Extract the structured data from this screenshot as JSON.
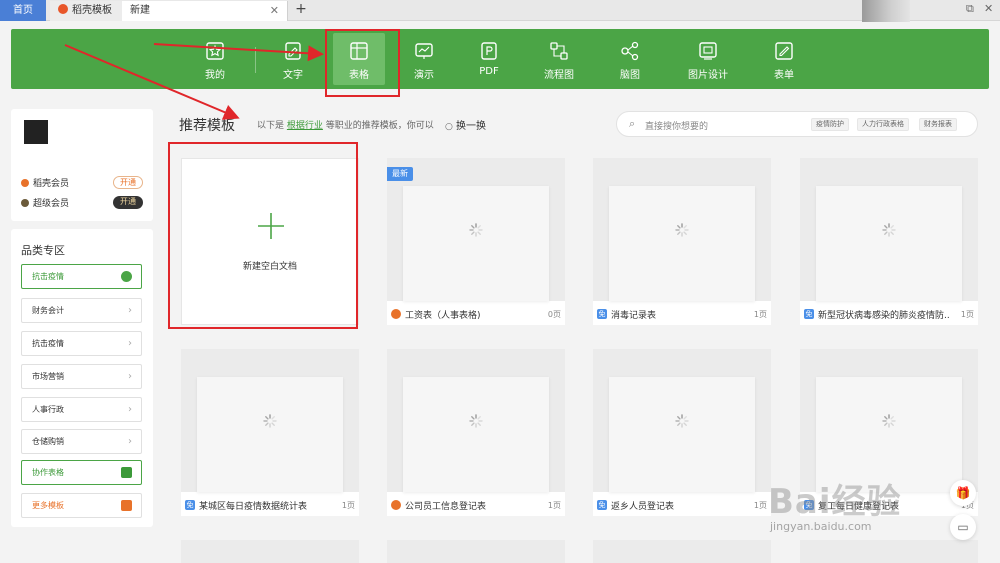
{
  "tabs": {
    "home": "首页",
    "docer": "稻壳模板",
    "new": "新建",
    "close_glyph": "✕",
    "add_glyph": "+"
  },
  "window": {
    "restore_glyph": "⧉",
    "close_glyph": "✕"
  },
  "toolbar": {
    "items": [
      {
        "label": "我的",
        "icon": "star-icon"
      },
      {
        "label": "文字",
        "icon": "writer-doc-icon"
      },
      {
        "label": "表格",
        "icon": "spreadsheet-icon",
        "active": true
      },
      {
        "label": "演示",
        "icon": "presentation-icon"
      },
      {
        "label": "PDF",
        "icon": "pdf-icon"
      },
      {
        "label": "流程图",
        "icon": "flowchart-icon"
      },
      {
        "label": "脑图",
        "icon": "mindmap-icon"
      },
      {
        "label": "图片设计",
        "icon": "image-design-icon"
      },
      {
        "label": "表单",
        "icon": "form-icon"
      }
    ],
    "bg_color": "#4ba546"
  },
  "user": {
    "docer_vip": "稻壳会员",
    "docer_vip_btn": "开通",
    "super_vip": "超级会员",
    "super_vip_btn": "开通"
  },
  "category": {
    "title": "品类专区",
    "items": [
      {
        "label": "抗击疫情",
        "style": "green"
      },
      {
        "label": "财务会计"
      },
      {
        "label": "抗击疫情"
      },
      {
        "label": "市场营销"
      },
      {
        "label": "人事行政"
      },
      {
        "label": "仓储购销"
      },
      {
        "label": "协作表格",
        "style": "green"
      },
      {
        "label": "更多模板",
        "style": "orange"
      }
    ]
  },
  "main": {
    "title": "推荐模板",
    "desc_prefix": "以下是",
    "desc_link": "根据行业",
    "desc_suffix": "等职业的推荐模板，你可以",
    "refresh_label": "换一换",
    "search_placeholder": "直接搜你想要的",
    "chips": [
      "疫情防护",
      "人力行政表格",
      "财务报表"
    ],
    "blank_label": "新建空白文档",
    "new_badge": "最新",
    "cards_row1": [
      {
        "name": "工资表（人事表格)",
        "pages": "0页",
        "tag": "docer"
      },
      {
        "name": "消毒记录表",
        "pages": "1页",
        "tag": "free"
      },
      {
        "name": "新型冠状病毒感染的肺炎疫情防...",
        "pages": "1页",
        "tag": "free"
      }
    ],
    "cards_row2": [
      {
        "name": "某城区每日疫情数据统计表",
        "pages": "1页",
        "tag": "free"
      },
      {
        "name": "公司员工信息登记表",
        "pages": "1页",
        "tag": "docer"
      },
      {
        "name": "返乡人员登记表",
        "pages": "1页",
        "tag": "free"
      },
      {
        "name": "复工每日健康登记表",
        "pages": "1页",
        "tag": "free"
      }
    ],
    "tag_free_glyph": "免"
  },
  "watermark": {
    "brand": "Bai经验",
    "url": "jingyan.baidu.com"
  },
  "colors": {
    "green": "#4ba546",
    "red_annotation": "#e0262a",
    "orange": "#e8722a",
    "blue": "#4a8fe8"
  }
}
